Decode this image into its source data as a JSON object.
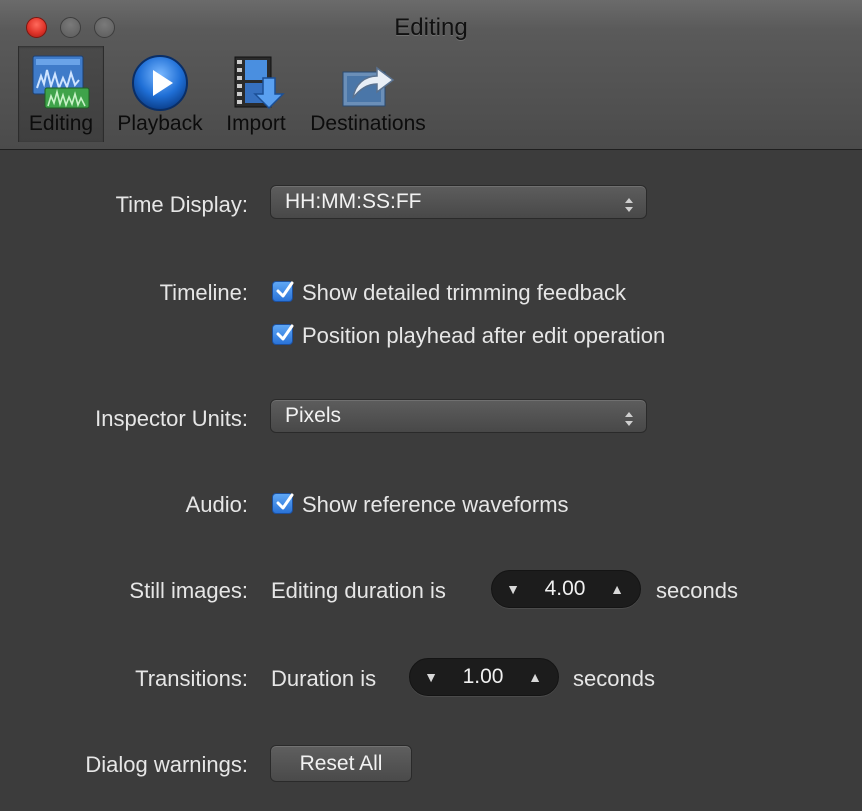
{
  "window": {
    "title": "Editing"
  },
  "toolbar": {
    "items": [
      {
        "label": "Editing",
        "icon": "editing-waveform-icon",
        "selected": true
      },
      {
        "label": "Playback",
        "icon": "play-circle-icon",
        "selected": false
      },
      {
        "label": "Import",
        "icon": "import-film-icon",
        "selected": false
      },
      {
        "label": "Destinations",
        "icon": "share-arrow-icon",
        "selected": false
      }
    ]
  },
  "settings": {
    "time_display": {
      "label": "Time Display:",
      "value": "HH:MM:SS:FF"
    },
    "timeline": {
      "label": "Timeline:",
      "options": [
        {
          "text": "Show detailed trimming feedback",
          "checked": true
        },
        {
          "text": "Position playhead after edit operation",
          "checked": true
        }
      ]
    },
    "inspector_units": {
      "label": "Inspector Units:",
      "value": "Pixels"
    },
    "audio": {
      "label": "Audio:",
      "option": {
        "text": "Show reference waveforms",
        "checked": true
      }
    },
    "still_images": {
      "label": "Still images:",
      "prefix": "Editing duration is",
      "value": "4.00",
      "suffix": "seconds"
    },
    "transitions": {
      "label": "Transitions:",
      "prefix": "Duration is",
      "value": "1.00",
      "suffix": "seconds"
    },
    "dialog_warnings": {
      "label": "Dialog warnings:",
      "button": "Reset All"
    }
  },
  "colors": {
    "background": "#3c3c3c",
    "checkbox_accent": "#2a73d8",
    "close_button": "#e0342a",
    "text": "#e6e6e6"
  }
}
